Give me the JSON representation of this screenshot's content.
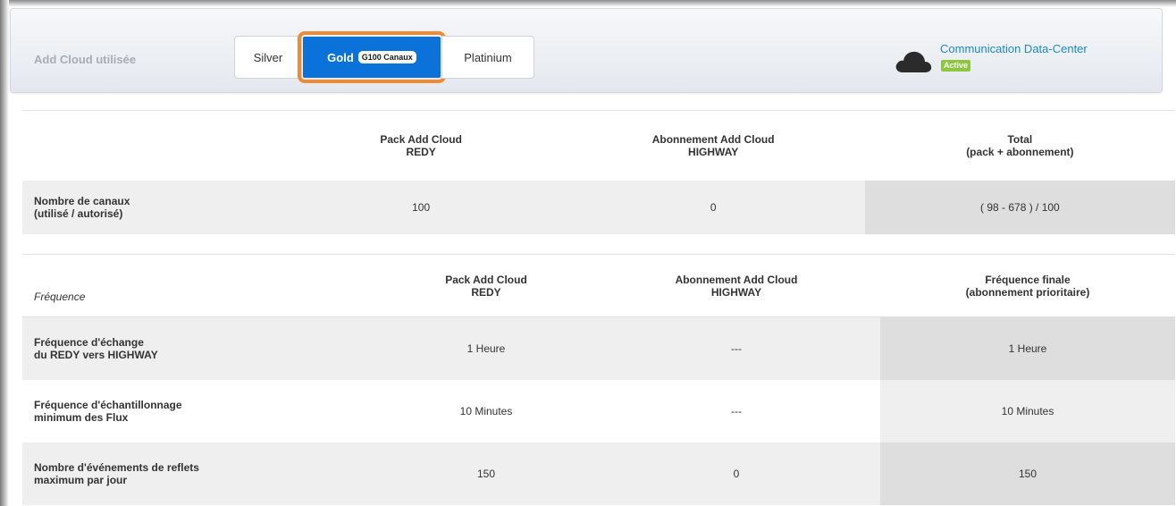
{
  "header": {
    "title": "Add Cloud utilisée",
    "tiers": [
      {
        "label": "Silver"
      },
      {
        "label": "Gold",
        "badge": "G100 Canaux"
      },
      {
        "label": "Platinium"
      }
    ],
    "selected_tier": "Gold",
    "datacenter": {
      "name": "Communication Data-Center",
      "status": "Active"
    },
    "colors": {
      "accent": "#0b72d9",
      "highlight": "#f08a33",
      "status": "#8dc63f",
      "link": "#1b8ac9"
    }
  },
  "channels_table": {
    "columns": [
      {
        "line1": "",
        "line2": ""
      },
      {
        "line1": "Pack Add Cloud",
        "line2": "REDY"
      },
      {
        "line1": "Abonnement Add Cloud",
        "line2": "HIGHWAY"
      },
      {
        "line1": "Total",
        "line2": "(pack + abonnement)"
      }
    ],
    "rows": [
      {
        "label1": "Nombre de canaux",
        "label2": "(utilisé / autorisé)",
        "pack": "100",
        "abonnement": "0",
        "total": "( 98 - 678 ) / 100"
      }
    ]
  },
  "frequency_table": {
    "columns": [
      {
        "line1": "",
        "line2": "Fréquence"
      },
      {
        "line1": "Pack Add Cloud",
        "line2": "REDY"
      },
      {
        "line1": "Abonnement Add Cloud",
        "line2": "HIGHWAY"
      },
      {
        "line1": "Fréquence finale",
        "line2": "(abonnement prioritaire)"
      }
    ],
    "rows": [
      {
        "label1": "Fréquence d'échange",
        "label2": "du REDY vers HIGHWAY",
        "pack": "1 Heure",
        "abonnement": "---",
        "final": "1 Heure"
      },
      {
        "label1": "Fréquence d'échantillonnage",
        "label2": "minimum des Flux",
        "pack": "10 Minutes",
        "abonnement": "---",
        "final": "10 Minutes"
      },
      {
        "label1": "Nombre d'événements de reflets",
        "label2": "maximum par jour",
        "pack": "150",
        "abonnement": "0",
        "final": "150"
      }
    ]
  }
}
